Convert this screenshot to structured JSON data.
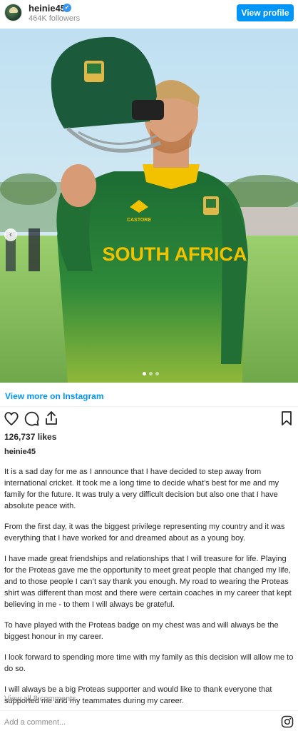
{
  "header": {
    "username": "heinie45",
    "verified_badge": "verified-icon",
    "followers": "464K followers",
    "view_profile_label": "View profile"
  },
  "post": {
    "image": {
      "description_icon": "post-photo",
      "shirt_text": "SOUTH AFRICA",
      "brand_text": "CASTORE",
      "carousel": {
        "total": 3,
        "active": 1
      }
    },
    "view_more_label": "View more on Instagram",
    "likes": "126,737 likes",
    "caption_username": "heinie45",
    "caption_paragraphs": [
      "It is a sad day for me as I announce that I have decided to step away from international cricket. It took me a long time to decide what’s best for me and my family for the future. It was truly a very difficult decision but also one that I have absolute peace with.",
      "From the first day, it was the biggest privilege representing my country and it was everything that I have worked for and dreamed about as a young boy.",
      "I have made great friendships and relationships that I will treasure for life. Playing for the Proteas gave me the opportunity to meet great people that changed my life, and to those people I can’t say thank you enough. My road to wearing the Proteas shirt was different than most and there were certain coaches in my career that kept believing in me - to them I will always be grateful.",
      "To have played with the Proteas badge on my chest was and will always be the biggest honour in my career.",
      "I look forward to spending more time with my family as this decision will allow me to do so.",
      "I will always be a big Proteas supporter and would like to thank everyone that supported me and my teammates during my career."
    ],
    "view_comments": "View all 8 comments",
    "add_comment_placeholder": "Add a comment..."
  },
  "icons": [
    "heart-icon",
    "comment-icon",
    "share-icon",
    "bookmark-icon",
    "instagram-icon",
    "chevron-left-icon"
  ],
  "colors": {
    "accent": "#0095f6",
    "text": "#262626",
    "muted": "#8e8e8e",
    "jersey_green": "#1f7a3a",
    "jersey_gold": "#f2c200"
  }
}
